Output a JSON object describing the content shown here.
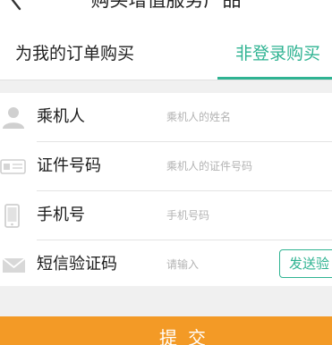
{
  "header": {
    "title": "购买增值服务产品",
    "back_icon": "chevron-left-icon"
  },
  "tabs": [
    {
      "label": "为我的订单购买",
      "active": false
    },
    {
      "label": "非登录购买",
      "active": true
    }
  ],
  "form": {
    "rows": [
      {
        "icon": "person-icon",
        "label": "乘机人",
        "placeholder": "乘机人的姓名"
      },
      {
        "icon": "id-card-icon",
        "label": "证件号码",
        "placeholder": "乘机人的证件号码"
      },
      {
        "icon": "phone-icon",
        "label": "手机号",
        "placeholder": "手机号码"
      },
      {
        "icon": "envelope-icon",
        "label": "短信验证码",
        "placeholder": "请输入"
      }
    ],
    "send_code_label": "发送验"
  },
  "submit": {
    "label": "提交"
  },
  "colors": {
    "accent": "#2fb392",
    "submit": "#f39a26"
  }
}
